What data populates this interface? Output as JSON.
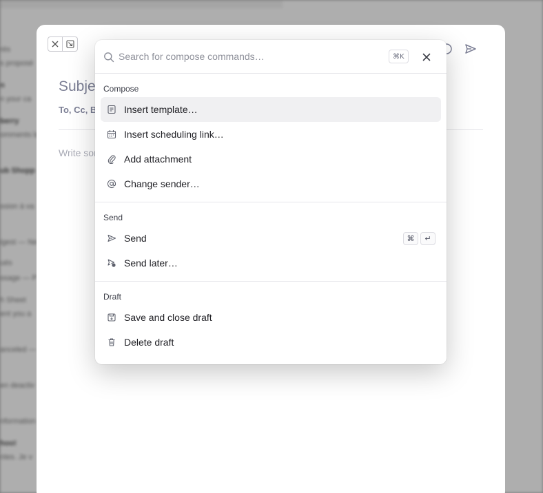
{
  "background_list": [
    {
      "text": "rés",
      "bold": false
    },
    {
      "text": "s proposé",
      "bold": false
    },
    {
      "text": "n",
      "bold": true
    },
    {
      "text": "n your ca",
      "bold": false
    },
    {
      "text": "berry",
      "bold": true
    },
    {
      "text": "omments las",
      "bold": false
    },
    {
      "text": "ub Shopp",
      "bold": true
    },
    {
      "text": "ssion à va",
      "bold": false
    },
    {
      "text": "igest — Ne",
      "bold": false
    },
    {
      "text": "ués",
      "bold": false
    },
    {
      "text": "ssage — P",
      "bold": false
    },
    {
      "text": "h Sheet",
      "bold": false
    },
    {
      "text": "ent you a",
      "bold": false
    },
    {
      "text": "anceled —",
      "bold": false
    },
    {
      "text": "en deactiv",
      "bold": false
    },
    {
      "text": "nformation",
      "bold": false
    },
    {
      "text": "hoo!",
      "bold": true
    },
    {
      "text": "ntes. Je v",
      "bold": false
    }
  ],
  "compose": {
    "subject_placeholder": "Subject",
    "recipients_label": "To, Cc, Bcc",
    "body_placeholder": "Write something…"
  },
  "palette": {
    "search": {
      "placeholder": "Search for compose commands…",
      "value": "",
      "shortcut": "⌘K"
    },
    "sections": [
      {
        "title": "Compose",
        "items": [
          {
            "label": "Insert template…",
            "icon": "template-icon",
            "active": true
          },
          {
            "label": "Insert scheduling link…",
            "icon": "calendar-icon",
            "active": false
          },
          {
            "label": "Add attachment",
            "icon": "paperclip-icon",
            "active": false
          },
          {
            "label": "Change sender…",
            "icon": "at-sign-icon",
            "active": false
          }
        ]
      },
      {
        "title": "Send",
        "items": [
          {
            "label": "Send",
            "icon": "send-icon",
            "active": false,
            "keys": [
              "⌘",
              "↵"
            ]
          },
          {
            "label": "Send later…",
            "icon": "send-later-icon",
            "active": false
          }
        ]
      },
      {
        "title": "Draft",
        "items": [
          {
            "label": "Save and close draft",
            "icon": "save-draft-icon",
            "active": false
          },
          {
            "label": "Delete draft",
            "icon": "trash-icon",
            "active": false
          }
        ]
      }
    ]
  },
  "colors": {
    "accent_text": "#1f1f24",
    "muted_text": "#7c7f95",
    "active_row": "#f0f0f2"
  }
}
